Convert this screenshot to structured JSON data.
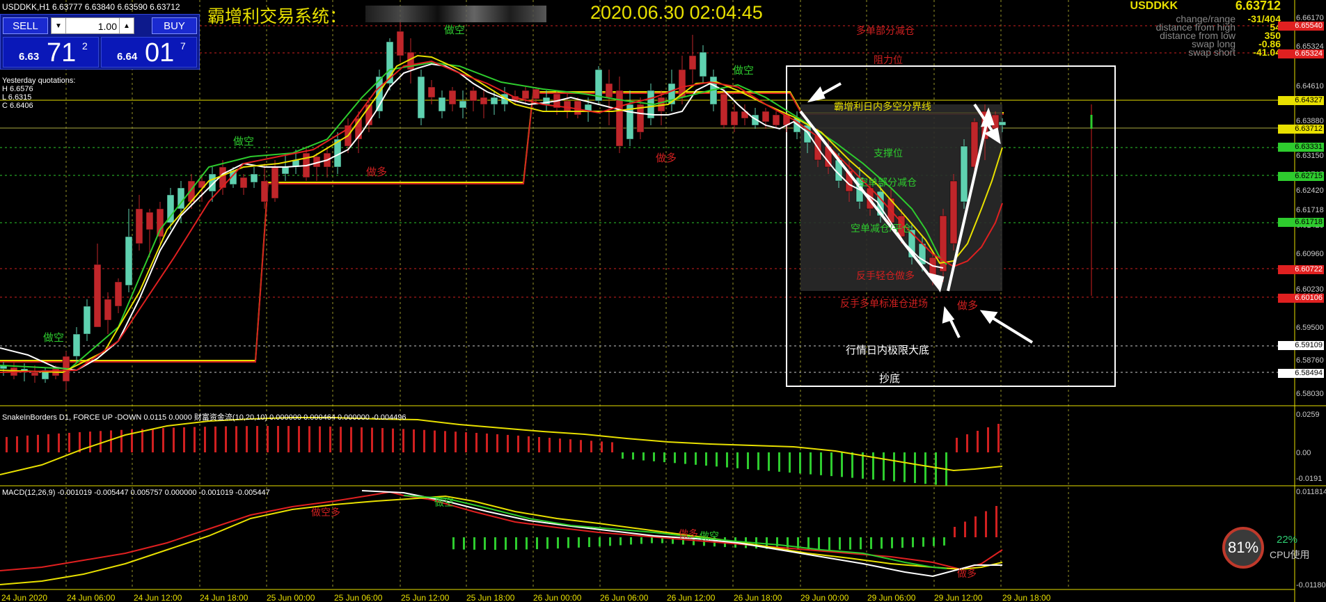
{
  "header": {
    "symbol_line": "USDDKK,H1  6.63777 6.63840 6.63590 6.63712"
  },
  "title": "霸增利交易系统：",
  "clock": "2020.06.30 02:04:45",
  "trade_panel": {
    "sell_label": "SELL",
    "buy_label": "BUY",
    "lot": "1.00",
    "sell_small": "6.63",
    "sell_big": "71",
    "sell_sup": "2",
    "buy_small": "6.64",
    "buy_big": "01",
    "buy_sup": "7"
  },
  "yesterday": {
    "title": "Yesterday quotations:",
    "h": "H 6.6576",
    "l": "L 6.6315",
    "c": "C 6.6406"
  },
  "info": {
    "symbol": "USDDKK",
    "price": "6.63712",
    "rows": [
      {
        "label": "change/range",
        "value": "-31/404"
      },
      {
        "label": "distance from high",
        "value": "54"
      },
      {
        "label": "distance from low",
        "value": "350"
      },
      {
        "label": "swap long",
        "value": "-0.86"
      },
      {
        "label": "swap short",
        "value": "-41.04"
      }
    ]
  },
  "price_scale": [
    "6.66170",
    "6.65540",
    "6.65324",
    "6.64610",
    "6.64327",
    "6.63880",
    "6.63712",
    "6.63331",
    "6.63150",
    "6.62715",
    "6.62420",
    "6.61718",
    "6.61420",
    "6.60960",
    "6.60722",
    "6.60230",
    "6.60106",
    "6.59500",
    "6.59109",
    "6.58760",
    "6.58494",
    "6.58030"
  ],
  "price_badges": [
    {
      "text": "6.65540",
      "color": "#e02020",
      "fg": "#fff"
    },
    {
      "text": "6.65324",
      "color": "#e02020",
      "fg": "#fff"
    },
    {
      "text": "6.64327",
      "color": "#e8e000",
      "fg": "#000"
    },
    {
      "text": "6.63712",
      "color": "#e8e000",
      "fg": "#000"
    },
    {
      "text": "6.63331",
      "color": "#2ecc2e",
      "fg": "#000"
    },
    {
      "text": "6.62715",
      "color": "#2ecc2e",
      "fg": "#000"
    },
    {
      "text": "6.61718",
      "color": "#2ecc2e",
      "fg": "#000"
    },
    {
      "text": "6.60722",
      "color": "#e02020",
      "fg": "#fff"
    },
    {
      "text": "6.60106",
      "color": "#e02020",
      "fg": "#fff"
    },
    {
      "text": "6.59109",
      "color": "#ffffff",
      "fg": "#000"
    },
    {
      "text": "6.58494",
      "color": "#ffffff",
      "fg": "#000"
    }
  ],
  "chart_labels": {
    "short1": "做空",
    "short2": "做空",
    "short3": "做空",
    "short4": "做空",
    "long1": "做多",
    "long2": "做多",
    "long3": "做多",
    "partial_close_long": "多单部分减仓",
    "resistance": "阻力位",
    "boundary": "霸增利日内多空分界线",
    "support": "支撑位",
    "partial_close_short": "空单部分减仓",
    "close_short": "空单减仓/平仓",
    "reverse_light_long": "反手轻仓做多",
    "reverse_std_long": "反手多单标准仓进场",
    "extreme_bottom": "行情日内极限大底",
    "bottom_fishing": "抄底"
  },
  "indicator1": {
    "header": "SnakeInBorders D1, FORCE UP -DOWN  0.0115 0.0000  财富资金流(10,20,10) 0.000000 0.000464 0.000000 -0.004496",
    "scale": [
      "0.0259",
      "0.00",
      "-0.0191"
    ]
  },
  "indicator2": {
    "header": "MACD(12,26,9) -0.001019 -0.005447 0.005757 0.000000 -0.001019 -0.005447",
    "scale": [
      "0.011814",
      "-0.01180"
    ],
    "labels": {
      "a": "做空多",
      "b": "做空",
      "c": "做多",
      "d": "做空",
      "e": "做多"
    }
  },
  "x_axis": [
    "24 Jun 2020",
    "24 Jun 06:00",
    "24 Jun 12:00",
    "24 Jun 18:00",
    "25 Jun 00:00",
    "25 Jun 06:00",
    "25 Jun 12:00",
    "25 Jun 18:00",
    "26 Jun 00:00",
    "26 Jun 06:00",
    "26 Jun 12:00",
    "26 Jun 18:00",
    "29 Jun 00:00",
    "29 Jun 06:00",
    "29 Jun 12:00",
    "29 Jun 18:00"
  ],
  "cpu": {
    "ring": "81%",
    "pct": "22%",
    "label": "CPU使用"
  }
}
